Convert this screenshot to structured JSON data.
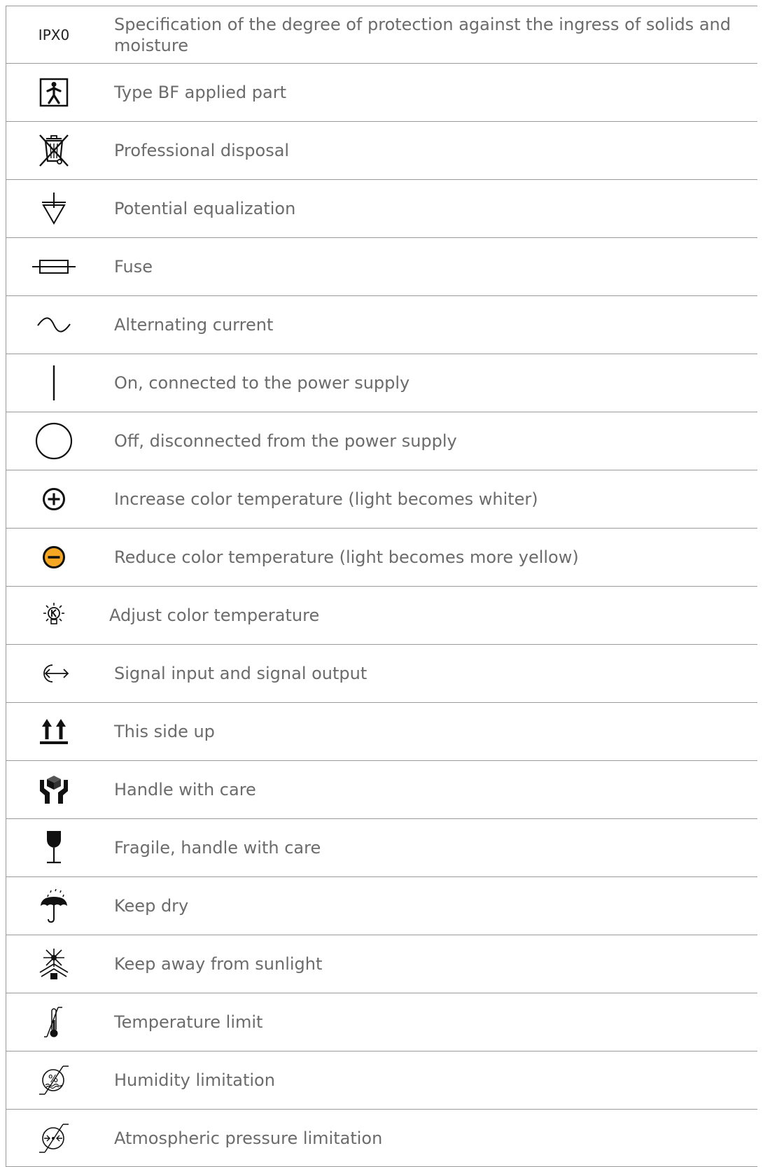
{
  "rows": [
    {
      "symbol": "ipx0-code",
      "symbol_text": "IPX0",
      "description": "Specification of the degree of protection against the ingress of solids and moisture"
    },
    {
      "symbol": "type-bf-applied-part-icon",
      "description": "Type BF applied part"
    },
    {
      "symbol": "crossed-out-bin-icon",
      "description": "Professional disposal"
    },
    {
      "symbol": "equipotential-icon",
      "description": "Potential equalization"
    },
    {
      "symbol": "fuse-icon",
      "description": "Fuse"
    },
    {
      "symbol": "alternating-current-icon",
      "description": "Alternating current"
    },
    {
      "symbol": "power-on-icon",
      "description": "On, connected to the power supply"
    },
    {
      "symbol": "power-off-icon",
      "description": "Off, disconnected from the power supply"
    },
    {
      "symbol": "plus-circle-icon",
      "description": "Increase color temperature (light becomes whiter)"
    },
    {
      "symbol": "minus-circle-icon",
      "description": "Reduce color temperature (light becomes more yellow)"
    },
    {
      "symbol": "color-temperature-icon",
      "description": "Adjust color temperature"
    },
    {
      "symbol": "signal-io-icon",
      "description": "Signal input and signal output"
    },
    {
      "symbol": "this-side-up-icon",
      "description": "This side up"
    },
    {
      "symbol": "handle-with-care-icon",
      "description": "Handle with care"
    },
    {
      "symbol": "fragile-icon",
      "description": "Fragile, handle with care"
    },
    {
      "symbol": "keep-dry-icon",
      "description": "Keep dry"
    },
    {
      "symbol": "keep-away-from-sunlight-icon",
      "description": "Keep away from sunlight"
    },
    {
      "symbol": "temperature-limit-icon",
      "description": "Temperature limit"
    },
    {
      "symbol": "humidity-limitation-icon",
      "description": "Humidity limitation"
    },
    {
      "symbol": "atmospheric-pressure-icon",
      "description": "Atmospheric pressure limitation"
    }
  ],
  "colors": {
    "minus_fill": "#f5a623",
    "text": "#6b6b6b",
    "border": "#9a9a9a"
  }
}
